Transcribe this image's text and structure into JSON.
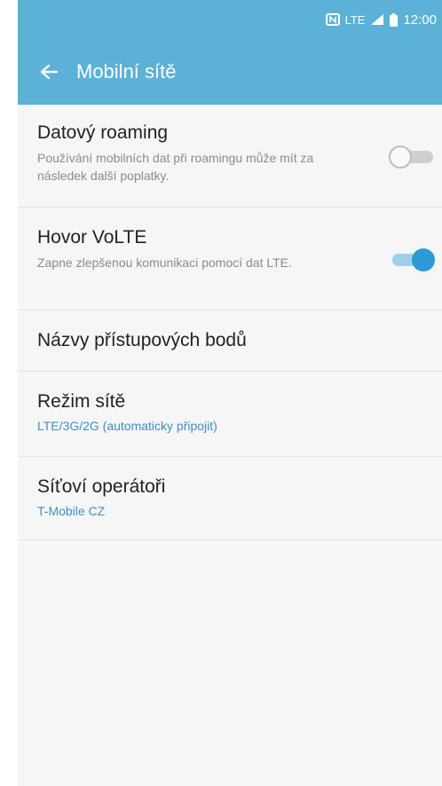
{
  "status": {
    "time": "12:00",
    "nfc_icon": "nfc-icon",
    "lte_label": "LTE",
    "signal_icon": "signal-icon",
    "battery_icon": "battery-icon"
  },
  "appbar": {
    "title": "Mobilní sítě",
    "back_icon": "back-arrow-icon",
    "color": "#5bb2d6"
  },
  "items": [
    {
      "title": "Datový roaming",
      "subtitle": "Používání mobilních dat při roamingu může mít za následek další poplatky.",
      "toggle": "off"
    },
    {
      "title": "Hovor VoLTE",
      "subtitle": "Zapne zlepšenou komunikaci pomocí dat LTE.",
      "toggle": "on"
    },
    {
      "title": "Názvy přístupových bodů"
    },
    {
      "title": "Režim sítě",
      "value": "LTE/3G/2G (automaticky připojit)"
    },
    {
      "title": "Síťoví operátoři",
      "value": "T-Mobile CZ"
    }
  ],
  "colors": {
    "accent": "#3f8fc4",
    "toggle_on": "#2c9ad4"
  }
}
